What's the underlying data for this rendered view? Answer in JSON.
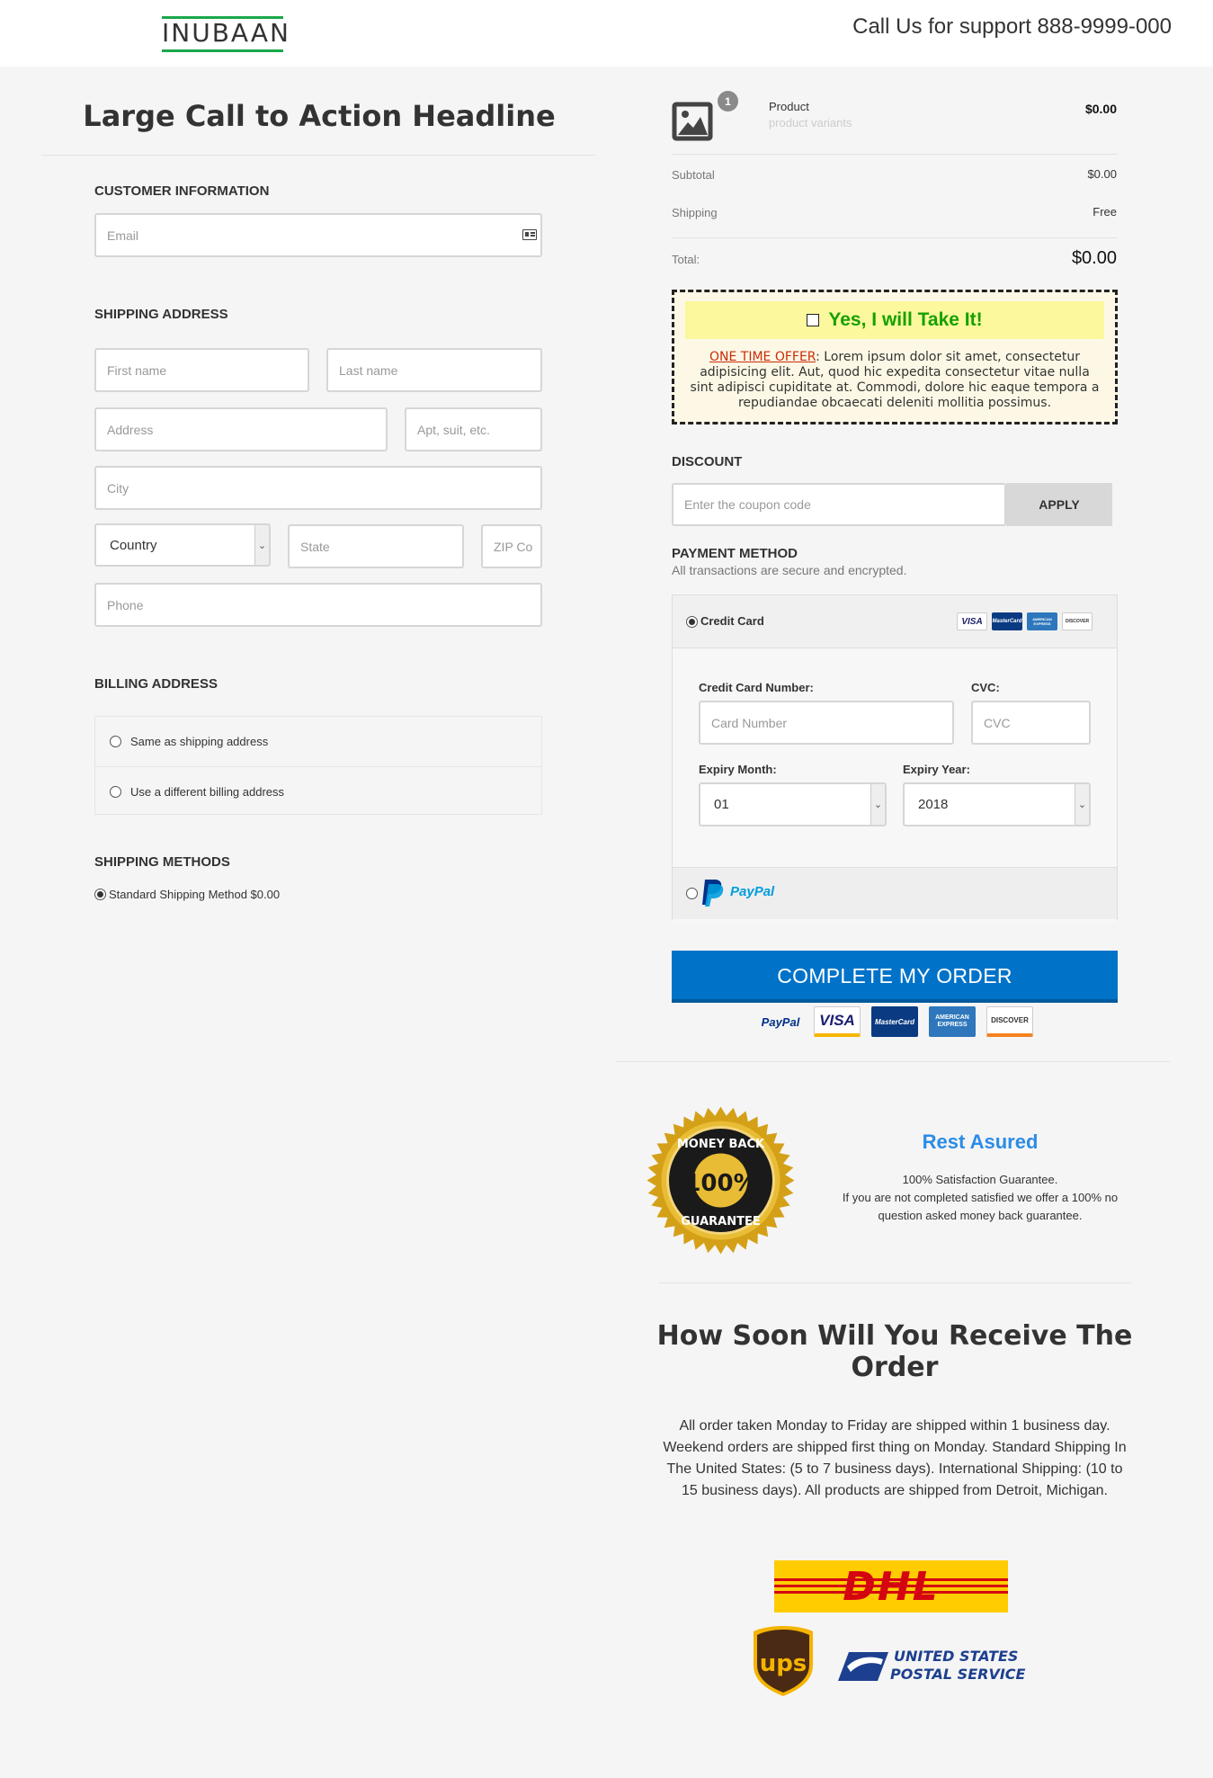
{
  "header": {
    "logo_text": "INUBAAN",
    "support": "Call Us for support 888-9999-000"
  },
  "headline": "Large Call to Action Headline",
  "customer": {
    "title": "CUSTOMER INFORMATION",
    "email_placeholder": "Email"
  },
  "shipping": {
    "title": "SHIPPING ADDRESS",
    "first_name": "First name",
    "last_name": "Last name",
    "address": "Address",
    "apt": "Apt, suit, etc.",
    "city": "City",
    "country": "Country",
    "state": "State",
    "zip": "ZIP Co",
    "phone": "Phone"
  },
  "billing": {
    "title": "BILLING ADDRESS",
    "options": [
      "Same as shipping address",
      "Use a different billing address"
    ]
  },
  "shipping_methods": {
    "title": "SHIPPING METHODS",
    "option": "Standard Shipping Method $0.00"
  },
  "order": {
    "badge": "1",
    "product_name": "Product",
    "product_variants": "product variants",
    "product_price": "$0.00",
    "subtotal_label": "Subtotal",
    "subtotal_value": "$0.00",
    "shipping_label": "Shipping",
    "shipping_value": "Free",
    "total_label": "Total:",
    "total_value": "$0.00"
  },
  "upsell": {
    "cta": "Yes, I will Take It!",
    "offer_label": "ONE TIME OFFER",
    "offer_text": ": Lorem ipsum dolor sit amet, consectetur adipisicing elit. Aut, quod hic expedita consectetur vitae nulla sint adipisci cupiditate at. Commodi, dolore hic eaque tempora a repudiandae obcaecati deleniti mollitia possimus."
  },
  "discount": {
    "title": "DISCOUNT",
    "placeholder": "Enter the coupon code",
    "apply": "APPLY"
  },
  "payment": {
    "title": "PAYMENT METHOD",
    "subtitle": "All transactions are secure and encrypted.",
    "credit_card": "Credit Card",
    "card_number_label": "Credit Card Number:",
    "card_number_placeholder": "Card Number",
    "cvc_label": "CVC:",
    "cvc_placeholder": "CVC",
    "expiry_month_label": "Expiry Month:",
    "expiry_month": "01",
    "expiry_year_label": "Expiry Year:",
    "expiry_year": "2018",
    "paypal": "PayPal",
    "cards": [
      "VISA",
      "MasterCard",
      "AMERICAN EXPRESS",
      "DISCOVER"
    ]
  },
  "cta": "COMPLETE MY ORDER",
  "guarantee": {
    "seal_top": "MONEY BACK",
    "seal_center": "100%",
    "seal_bottom": "GUARANTEE",
    "title": "Rest Asured",
    "line1": "100% Satisfaction Guarantee.",
    "line2": "If you are not completed satisfied we offer a 100%  no question asked money back guarantee."
  },
  "delivery": {
    "title": "How Soon Will You Receive The Order",
    "text": "All order taken Monday to Friday are shipped within 1 business day. Weekend orders are shipped first thing on Monday. Standard Shipping In The United States: (5 to 7 business days). International Shipping: (10 to 15 business days). All products are shipped from Detroit, Michigan.",
    "dhl": "DHL",
    "ups": "ups",
    "usps_line1": "UNITED STATES",
    "usps_line2": "POSTAL SERVICE"
  },
  "colors": {
    "brand_green": "#19a84a",
    "cta_blue": "#0073c9",
    "title_blue": "#2b8ce6",
    "upsell_green": "#16a100",
    "offer_red": "#c92c0a"
  }
}
